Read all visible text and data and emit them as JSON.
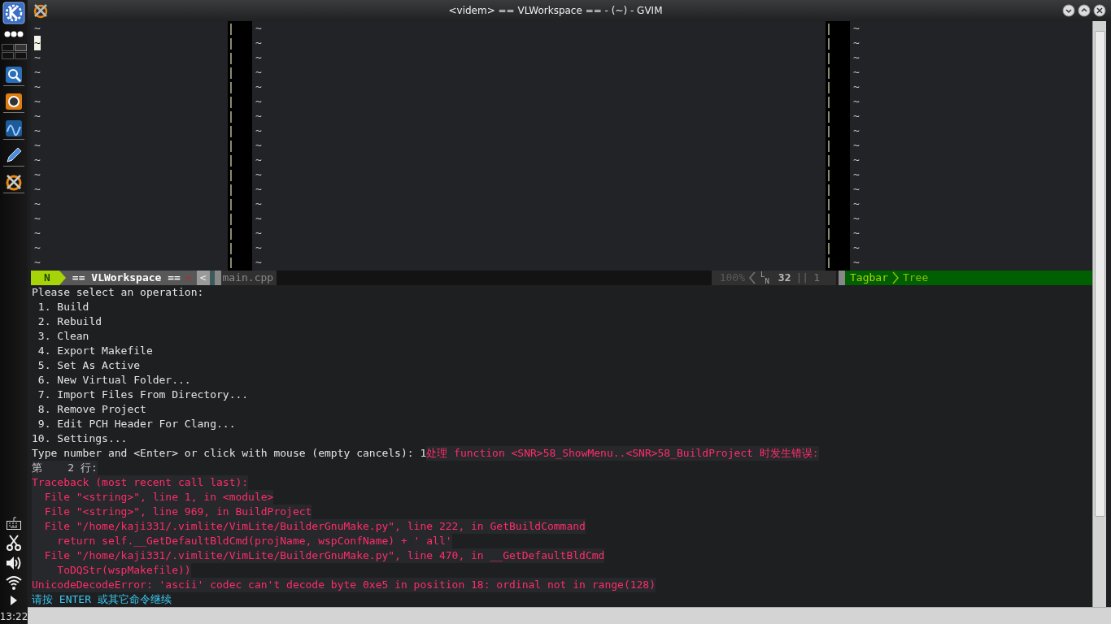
{
  "panel": {
    "clock": "13:22"
  },
  "window": {
    "title": "<videm> == VLWorkspace == - (~) - GVIM"
  },
  "panes": [
    {
      "lines": [
        {
          "text": "~",
          "cursor": false
        },
        {
          "text": "~",
          "cursor": true
        },
        {
          "text": "~",
          "cursor": false
        },
        {
          "text": "~",
          "cursor": false
        },
        {
          "text": "~",
          "cursor": false
        },
        {
          "text": "~",
          "cursor": false
        },
        {
          "text": "~",
          "cursor": false
        },
        {
          "text": "~",
          "cursor": false
        },
        {
          "text": "~",
          "cursor": false
        },
        {
          "text": "~",
          "cursor": false
        },
        {
          "text": "~",
          "cursor": false
        },
        {
          "text": "~",
          "cursor": false
        },
        {
          "text": "~",
          "cursor": false
        },
        {
          "text": "~",
          "cursor": false
        },
        {
          "text": "~",
          "cursor": false
        },
        {
          "text": "~",
          "cursor": false
        },
        {
          "text": "~",
          "cursor": false
        }
      ]
    },
    {
      "lines": [
        {
          "text": "~",
          "cursor": false
        },
        {
          "text": "~",
          "cursor": false
        },
        {
          "text": "~",
          "cursor": false
        },
        {
          "text": "~",
          "cursor": false
        },
        {
          "text": "~",
          "cursor": false
        },
        {
          "text": "~",
          "cursor": false
        },
        {
          "text": "~",
          "cursor": false
        },
        {
          "text": "~",
          "cursor": false
        },
        {
          "text": "~",
          "cursor": false
        },
        {
          "text": "~",
          "cursor": false
        },
        {
          "text": "~",
          "cursor": false
        },
        {
          "text": "~",
          "cursor": false
        },
        {
          "text": "~",
          "cursor": false
        },
        {
          "text": "~",
          "cursor": false
        },
        {
          "text": "~",
          "cursor": false
        },
        {
          "text": "~",
          "cursor": false
        },
        {
          "text": "~",
          "cursor": false
        }
      ]
    },
    {
      "lines": [
        {
          "text": "~",
          "cursor": false
        },
        {
          "text": "~",
          "cursor": false
        },
        {
          "text": "~",
          "cursor": false
        },
        {
          "text": "~",
          "cursor": false
        },
        {
          "text": "~",
          "cursor": false
        },
        {
          "text": "~",
          "cursor": false
        },
        {
          "text": "~",
          "cursor": false
        },
        {
          "text": "~",
          "cursor": false
        },
        {
          "text": "~",
          "cursor": false
        },
        {
          "text": "~",
          "cursor": false
        },
        {
          "text": "~",
          "cursor": false
        },
        {
          "text": "~",
          "cursor": false
        },
        {
          "text": "~",
          "cursor": false
        },
        {
          "text": "~",
          "cursor": false
        },
        {
          "text": "~",
          "cursor": false
        },
        {
          "text": "~",
          "cursor": false
        },
        {
          "text": "~",
          "cursor": false
        }
      ]
    }
  ],
  "statusline": {
    "mode": "N",
    "workspace": "== VLWorkspace ==",
    "modified_flag": "-",
    "tab_marker": "<",
    "tab": "main.cpp",
    "percent": "100%",
    "line_symbol": "LN",
    "line": "32",
    "separator": "||",
    "column": "1",
    "sidebar_name": "Tagbar",
    "sidebar_view": "Tree"
  },
  "messages": [
    {
      "segments": [
        {
          "kind": "normal",
          "text": "Please select an operation:"
        }
      ]
    },
    {
      "segments": [
        {
          "kind": "normal",
          "text": " 1. Build"
        }
      ]
    },
    {
      "segments": [
        {
          "kind": "normal",
          "text": " 2. Rebuild"
        }
      ]
    },
    {
      "segments": [
        {
          "kind": "normal",
          "text": " 3. Clean"
        }
      ]
    },
    {
      "segments": [
        {
          "kind": "normal",
          "text": " 4. Export Makefile"
        }
      ]
    },
    {
      "segments": [
        {
          "kind": "normal",
          "text": " 5. Set As Active"
        }
      ]
    },
    {
      "segments": [
        {
          "kind": "normal",
          "text": " 6. New Virtual Folder..."
        }
      ]
    },
    {
      "segments": [
        {
          "kind": "normal",
          "text": " 7. Import Files From Directory..."
        }
      ]
    },
    {
      "segments": [
        {
          "kind": "normal",
          "text": " 8. Remove Project"
        }
      ]
    },
    {
      "segments": [
        {
          "kind": "normal",
          "text": " 9. Edit PCH Header For Clang..."
        }
      ]
    },
    {
      "segments": [
        {
          "kind": "normal",
          "text": "10. Settings..."
        }
      ]
    },
    {
      "segments": [
        {
          "kind": "normal",
          "text": "Type number and <Enter> or click with mouse (empty cancels): 1"
        },
        {
          "kind": "error",
          "text": "处理 function <SNR>58_ShowMenu..<SNR>58_BuildProject 时发生错误:"
        }
      ]
    },
    {
      "segments": [
        {
          "kind": "info",
          "text": "第    2 行:"
        }
      ]
    },
    {
      "segments": [
        {
          "kind": "error",
          "text": "Traceback (most recent call last):"
        }
      ]
    },
    {
      "segments": [
        {
          "kind": "error",
          "text": "  File \"<string>\", line 1, in <module>"
        }
      ]
    },
    {
      "segments": [
        {
          "kind": "error",
          "text": "  File \"<string>\", line 969, in BuildProject"
        }
      ]
    },
    {
      "segments": [
        {
          "kind": "error",
          "text": "  File \"/home/kaji331/.vimlite/VimLite/BuilderGnuMake.py\", line 222, in GetBuildCommand"
        }
      ]
    },
    {
      "segments": [
        {
          "kind": "error",
          "text": "    return self.__GetDefaultBldCmd(projName, wspConfName) + ' all'"
        }
      ]
    },
    {
      "segments": [
        {
          "kind": "error",
          "text": "  File \"/home/kaji331/.vimlite/VimLite/BuilderGnuMake.py\", line 470, in __GetDefaultBldCmd"
        }
      ]
    },
    {
      "segments": [
        {
          "kind": "error",
          "text": "    ToDQStr(wspMakefile))"
        }
      ]
    },
    {
      "segments": [
        {
          "kind": "error",
          "text": "UnicodeDecodeError: 'ascii' codec can't decode byte 0xe5 in position 18: ordinal not in range(128)"
        }
      ]
    },
    {
      "segments": [
        {
          "kind": "more",
          "text": "请按 ENTER 或其它命令继续"
        }
      ]
    }
  ]
}
